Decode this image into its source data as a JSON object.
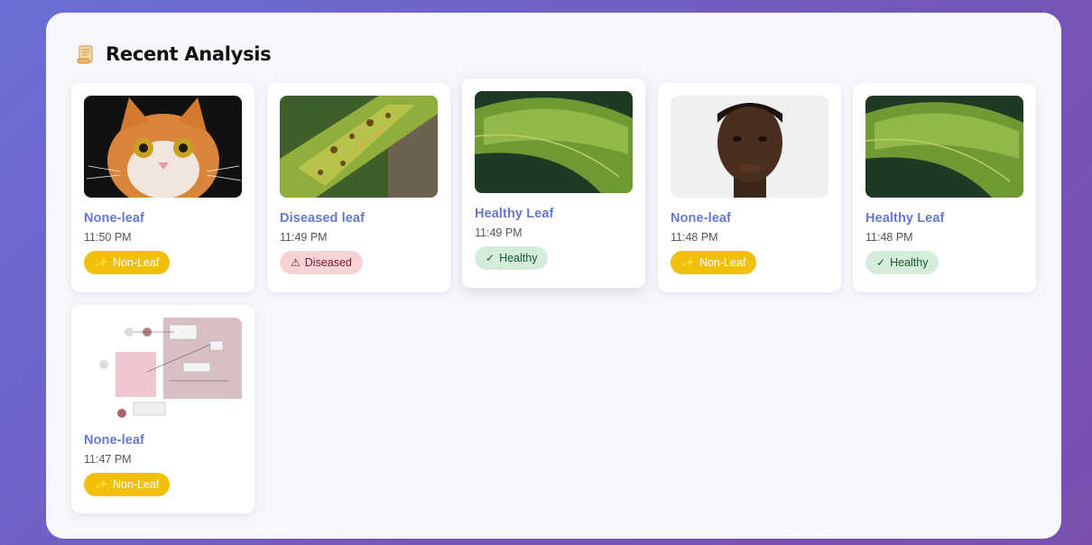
{
  "header": {
    "icon": "scroll-icon",
    "title": "Recent Analysis"
  },
  "cards": [
    {
      "title": "None-leaf",
      "time": "11:50 PM",
      "thumb": "cat-photo",
      "badge": {
        "label": "Non-Leaf",
        "type": "nonleaf",
        "icon": "sparkle-icon",
        "glyph": "✨"
      }
    },
    {
      "title": "Diseased leaf",
      "time": "11:49 PM",
      "thumb": "diseased-leaf-photo",
      "badge": {
        "label": "Diseased",
        "type": "diseased",
        "icon": "warning-icon",
        "glyph": "⚠"
      }
    },
    {
      "title": "Healthy Leaf",
      "time": "11:49 PM",
      "thumb": "healthy-leaf-photo",
      "badge": {
        "label": "Healthy",
        "type": "healthy",
        "icon": "check-icon",
        "glyph": "✓"
      }
    },
    {
      "title": "None-leaf",
      "time": "11:48 PM",
      "thumb": "portrait-photo",
      "badge": {
        "label": "Non-Leaf",
        "type": "nonleaf",
        "icon": "sparkle-icon",
        "glyph": "✨"
      }
    },
    {
      "title": "Healthy Leaf",
      "time": "11:48 PM",
      "thumb": "healthy-leaf-photo",
      "badge": {
        "label": "Healthy",
        "type": "healthy",
        "icon": "check-icon",
        "glyph": "✓"
      }
    },
    {
      "title": "None-leaf",
      "time": "11:47 PM",
      "thumb": "diagram-screenshot",
      "badge": {
        "label": "Non-Leaf",
        "type": "nonleaf",
        "icon": "sparkle-icon",
        "glyph": "✨"
      }
    }
  ],
  "colors": {
    "accent_title": "#6678c8",
    "nonleaf": "#f2bf0b",
    "diseased": "#f5d2d6",
    "healthy": "#d4ecda"
  }
}
